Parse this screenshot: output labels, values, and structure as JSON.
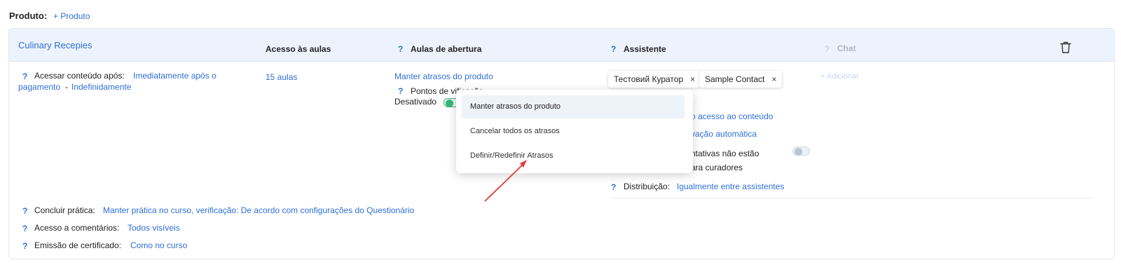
{
  "product_row": {
    "label": "Produto:",
    "add_link": "+ Produto"
  },
  "card": {
    "title": "Culinary Recepies",
    "headers": {
      "access": "Acesso às aulas",
      "opening_q": "?",
      "opening": "Aulas de abertura",
      "assistant_q": "?",
      "assistant": "Assistente",
      "chat_q": "?",
      "chat": "Chat"
    },
    "access_content": {
      "q": "?",
      "label": "Acessar conteúdo após:",
      "value_line1": "Imediatamente após o",
      "value_line2": "pagamento",
      "separator": "-",
      "duration": "Indefinidamente"
    },
    "lessons": "15 aulas",
    "opening": {
      "delay_link": "Manter atrasos do produto",
      "checkpoints_q": "?",
      "checkpoints_label": "Pontos de v",
      "checkpoints_suffix": "ificação",
      "status": "Desativado"
    },
    "assistant": {
      "chips": [
        "Тестовий Куратор",
        "Sample Contact"
      ],
      "chip_remove": "×",
      "line1": "o acesso ao conteúdo",
      "line2": "vação automática",
      "line3a": "ntativas não estão",
      "line3b": "ara curadores",
      "distribution_q": "?",
      "distribution_label": "Distribuição:",
      "distribution_value": "Igualmente entre assistentes"
    },
    "chat_add": "+ Adicionar",
    "footer": [
      {
        "q": "?",
        "label": "Concluir prática:",
        "value": "Manter prática no curso, verificação: De acordo com configurações do Questionário"
      },
      {
        "q": "?",
        "label": "Acesso a comentários:",
        "value": "Todos visíveis"
      },
      {
        "q": "?",
        "label": "Emissão de certificado:",
        "value": "Como no curso"
      }
    ]
  },
  "dropdown": {
    "options": [
      "Manter atrasos do produto",
      "Cancelar todos os atrasos",
      "Definir/Redefinir Atrasos"
    ],
    "selected_index": 0
  },
  "colors": {
    "link": "#2f6fd6",
    "header_bg": "#edf3fc",
    "toggle_on": "#3bb37a",
    "annotation_arrow": "#e53935"
  },
  "icons": {
    "delete": "trash-icon",
    "help": "question-icon"
  }
}
